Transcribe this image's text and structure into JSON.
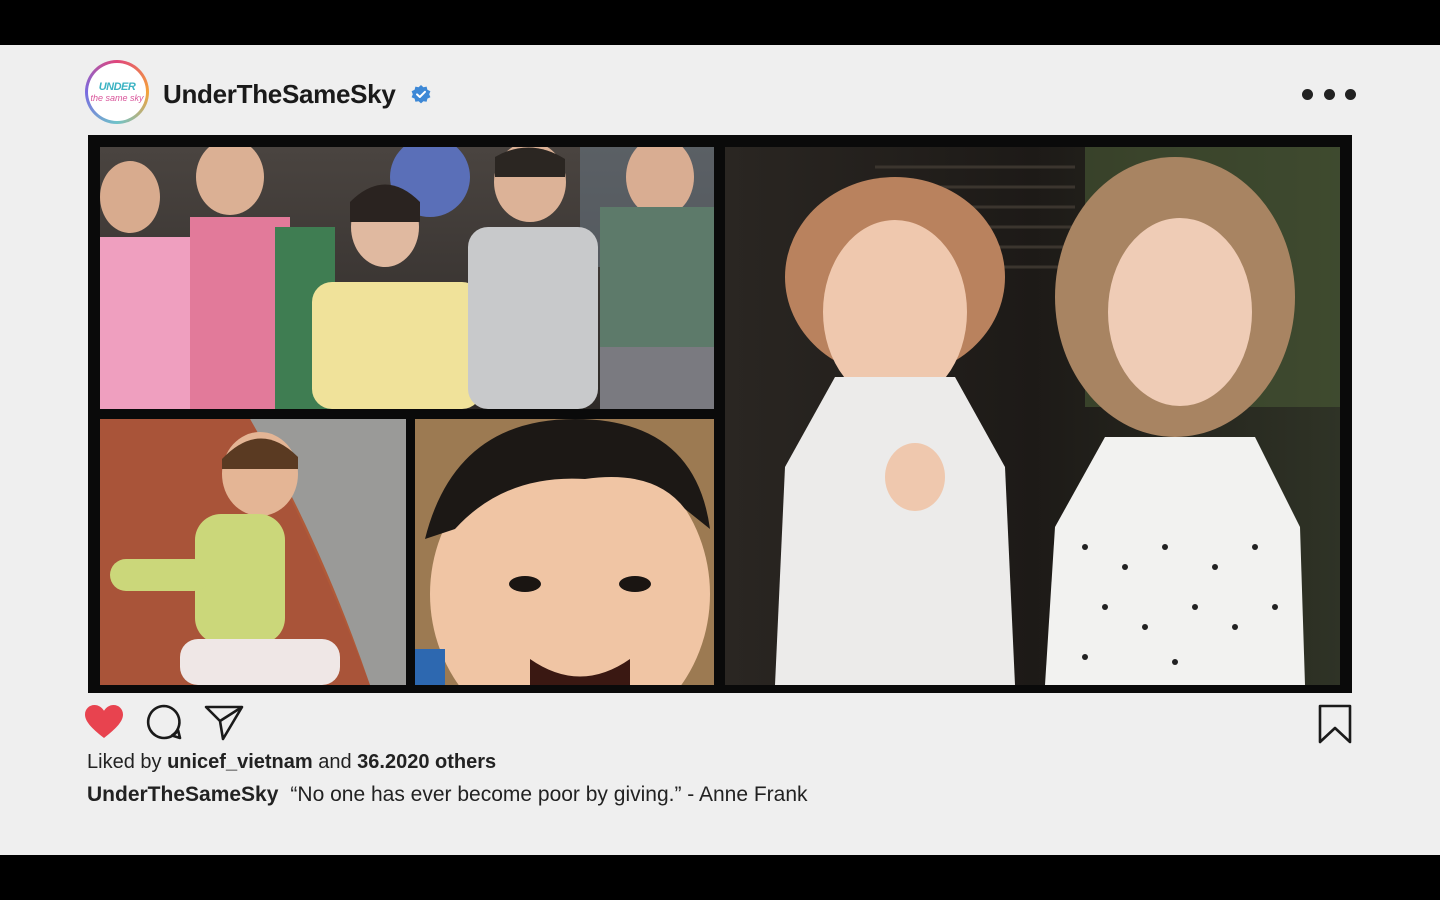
{
  "post": {
    "avatar_logo_line1": "UNDER",
    "avatar_logo_line2": "the same sky",
    "username": "UnderTheSameSky",
    "verified_icon": "verified-badge-icon",
    "more_icon": "more-dots-icon",
    "collage": [
      {
        "name": "children-clapping-photo"
      },
      {
        "name": "boy-on-hillside-photo"
      },
      {
        "name": "smiling-baby-photo"
      },
      {
        "name": "two-hosts-photo"
      }
    ],
    "actions": {
      "like_icon": "heart-icon",
      "comment_icon": "comment-icon",
      "share_icon": "send-icon",
      "save_icon": "bookmark-icon"
    },
    "likes": {
      "prefix": "Liked by",
      "user": "unicef_vietnam",
      "middle": "and",
      "count": "36.2020 others"
    },
    "caption": {
      "user": "UnderTheSameSky",
      "text": "“No one has ever become poor by giving.” - Anne Frank"
    },
    "colors": {
      "like": "#e8434f",
      "verified": "#3d88d6",
      "background": "#efefef"
    }
  }
}
